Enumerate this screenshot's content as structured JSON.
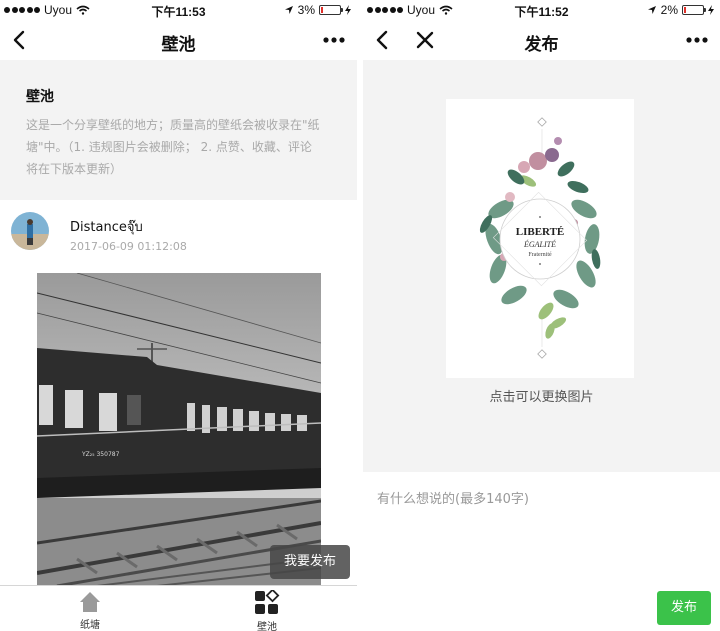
{
  "left": {
    "status": {
      "carrier": "Uyou",
      "time": "下午11:53",
      "battery": "3%",
      "battery_level": 0.03
    },
    "nav": {
      "title": "壁池"
    },
    "intro": {
      "title": "壁池",
      "line1": "这是一个分享壁纸的地方；质量高的壁纸会被收录在\"纸",
      "line2": "塘\"中。（1. 违规图片会被删除；   2. 点赞、收藏、评论",
      "line3": "将在下版本更新）"
    },
    "post": {
      "username": "Distanceจุ๊บ",
      "time": "2017-06-09 01:12:08",
      "car_number": "YZ₂₅ 350787"
    },
    "floating_button": "我要发布",
    "tabs": [
      {
        "label": "纸塘",
        "icon": "home-icon"
      },
      {
        "label": "壁池",
        "icon": "grid-icon"
      }
    ]
  },
  "right": {
    "status": {
      "carrier": "Uyou",
      "time": "下午11:52",
      "battery": "2%",
      "battery_level": 0.02
    },
    "nav": {
      "title": "发布"
    },
    "card": {
      "line1": "LIBERTÉ",
      "line2": "ÉGALITÉ",
      "line3": "Fraternité"
    },
    "hint": "点击可以更换图片",
    "compose_placeholder": "有什么想说的(最多140字)",
    "publish_button": "发布"
  },
  "colors": {
    "accent_green": "#3bc24a",
    "battery_red": "#e0302a",
    "panel_bg": "#f3f3f3"
  }
}
